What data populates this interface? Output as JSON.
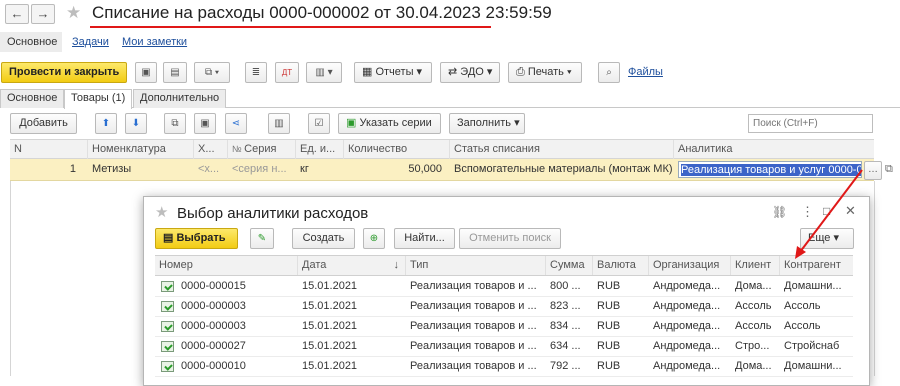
{
  "window": {
    "title": "Списание на расходы 0000-000002 от 30.04.2023 23:59:59"
  },
  "nav": {
    "back": "←",
    "forward": "→",
    "star": "★"
  },
  "section_tabs": [
    "Основное",
    "Задачи",
    "Мои заметки"
  ],
  "toolbar": {
    "post_close": "Провести и закрыть",
    "reports": "Отчеты",
    "edo": "ЭДО",
    "print": "Печать",
    "files": "Файлы"
  },
  "tabs": [
    "Основное",
    "Товары (1)",
    "Дополнительно"
  ],
  "goods_toolbar": {
    "add": "Добавить",
    "specify_series": "Указать серии",
    "fill": "Заполнить",
    "search_placeholder": "Поиск (Ctrl+F)"
  },
  "goods_table": {
    "headers": [
      "N",
      "Номенклатура",
      "Х...",
      "Серия",
      "Ед. и...",
      "Количество",
      "Статья списания",
      "Аналитика"
    ],
    "row": {
      "n": "1",
      "item": "Метизы",
      "char": "<х...",
      "series": "<серия н...",
      "unit": "кг",
      "qty": "50,000",
      "article": "Вспомогательные материалы (монтаж МК)",
      "analytics": "Реализация товаров и услуг 0000-00"
    }
  },
  "dialog": {
    "title": "Выбор аналитики расходов",
    "select": "Выбрать",
    "create": "Создать",
    "find": "Найти...",
    "cancel_search": "Отменить поиск",
    "more": "Еще",
    "headers": [
      "Номер",
      "Дата",
      "Тип",
      "Сумма",
      "Валюта",
      "Организация",
      "Клиент",
      "Контрагент"
    ],
    "rows": [
      [
        "0000-000015",
        "15.01.2021",
        "Реализация товаров и ...",
        "800 ...",
        "RUB",
        "Андромеда...",
        "Дома...",
        "Домашни..."
      ],
      [
        "0000-000003",
        "15.01.2021",
        "Реализация товаров и ...",
        "823 ...",
        "RUB",
        "Андромеда...",
        "Ассоль",
        "Ассоль"
      ],
      [
        "0000-000003",
        "15.01.2021",
        "Реализация товаров и ...",
        "834 ...",
        "RUB",
        "Андромеда...",
        "Ассоль",
        "Ассоль"
      ],
      [
        "0000-000027",
        "15.01.2021",
        "Реализация товаров и ...",
        "634 ...",
        "RUB",
        "Андромеда...",
        "Стро...",
        "Стройснаб"
      ],
      [
        "0000-000010",
        "15.01.2021",
        "Реализация товаров и ...",
        "792 ...",
        "RUB",
        "Андромеда...",
        "Дома...",
        "Домашни..."
      ]
    ]
  },
  "colors": {
    "accent_yellow": "#f5d31f",
    "annotation_red": "#e01818",
    "row_highlight": "#fbf0c2",
    "selection_blue": "#3c64c8"
  }
}
